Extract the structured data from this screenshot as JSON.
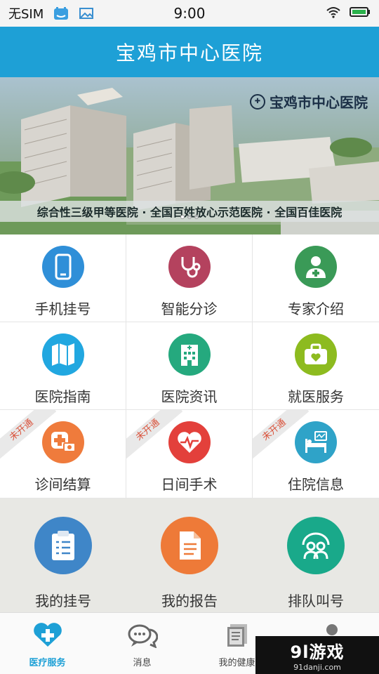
{
  "status_bar": {
    "carrier": "无SIM",
    "time": "9:00"
  },
  "header": {
    "title": "宝鸡市中心医院"
  },
  "banner": {
    "hospital_name": "宝鸡市中心医院",
    "slogan": "综合性三级甲等医院 · 全国百姓放心示范医院 · 全国百佳医院"
  },
  "services": [
    {
      "label": "手机挂号",
      "icon": "phone-icon",
      "color": "#2f8fd8",
      "badge": ""
    },
    {
      "label": "智能分诊",
      "icon": "stethoscope-icon",
      "color": "#b4425e",
      "badge": ""
    },
    {
      "label": "专家介绍",
      "icon": "doctor-icon",
      "color": "#3a9a57",
      "badge": ""
    },
    {
      "label": "医院指南",
      "icon": "map-icon",
      "color": "#21a7e0",
      "badge": ""
    },
    {
      "label": "医院资讯",
      "icon": "hospital-building-icon",
      "color": "#25a97e",
      "badge": ""
    },
    {
      "label": "就医服务",
      "icon": "medical-kit-icon",
      "color": "#8dbb1f",
      "badge": ""
    },
    {
      "label": "诊间结算",
      "icon": "payment-icon",
      "color": "#ef7b3c",
      "badge": "未开通"
    },
    {
      "label": "日间手术",
      "icon": "heartbeat-icon",
      "color": "#e3403b",
      "badge": "未开通"
    },
    {
      "label": "住院信息",
      "icon": "hospital-bed-icon",
      "color": "#2fa3c8",
      "badge": "未开通"
    }
  ],
  "my_section": [
    {
      "label": "我的挂号",
      "icon": "clipboard-icon",
      "color": "#3f86c8"
    },
    {
      "label": "我的报告",
      "icon": "report-icon",
      "color": "#ee7a38"
    },
    {
      "label": "排队叫号",
      "icon": "queue-icon",
      "color": "#19a98a"
    }
  ],
  "tabs": [
    {
      "label": "医疗服务",
      "icon": "heart-plus-icon",
      "active": true
    },
    {
      "label": "消息",
      "icon": "chat-icon",
      "active": false
    },
    {
      "label": "我的健康",
      "icon": "documents-icon",
      "active": false
    },
    {
      "label": "",
      "icon": "person-icon",
      "active": false
    }
  ],
  "watermark": {
    "main": "9l游戏",
    "sub": "91danji.com"
  }
}
